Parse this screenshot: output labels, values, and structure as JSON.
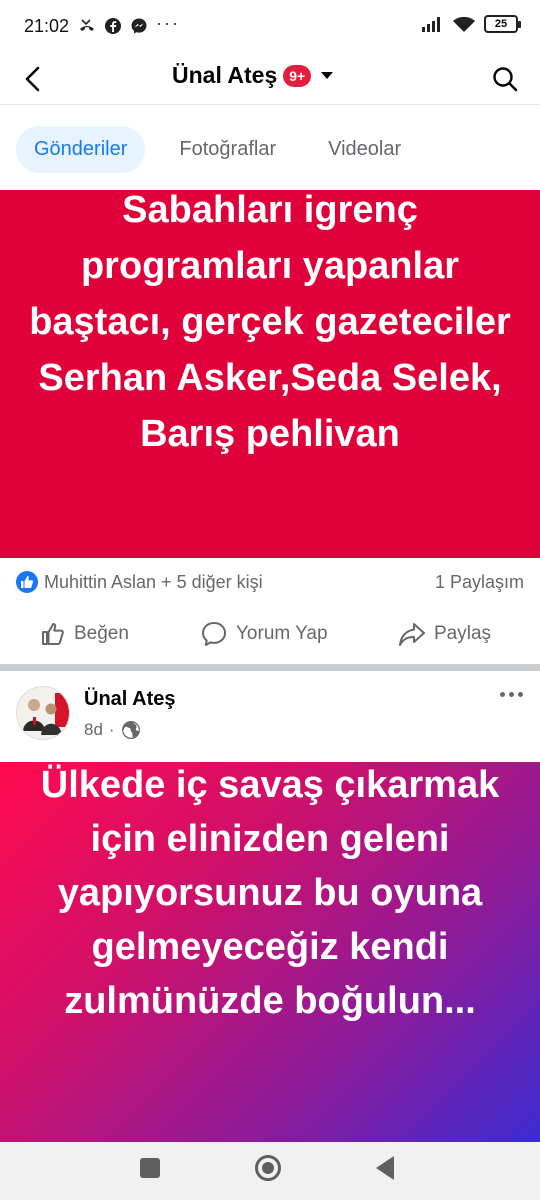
{
  "status_bar": {
    "time": "21:02",
    "dots": "···",
    "battery": "25"
  },
  "header": {
    "title": "Ünal Ateş",
    "badge": "9+"
  },
  "tabs": [
    {
      "label": "Gönderiler",
      "active": true
    },
    {
      "label": "Fotoğraflar",
      "active": false
    },
    {
      "label": "Videolar",
      "active": false
    }
  ],
  "post1": {
    "text": "Sabahları igrenç programları yapanlar baştacı, gerçek gazeteciler Serhan Asker,Seda Selek, Barış pehlivan",
    "background": "#e0003a",
    "reactions": "Muhittin Aslan + 5 diğer kişi",
    "shares": "1 Paylaşım",
    "actions": {
      "like": "Beğen",
      "comment": "Yorum Yap",
      "share": "Paylaş"
    }
  },
  "post2": {
    "author": "Ünal Ateş",
    "time": "8d",
    "text": "Ülkede iç savaş çıkarmak için elinizden geleni yapıyorsunuz bu oyuna gelmeyeceğiz kendi zulmünüzde boğulun..."
  },
  "colors": {
    "accent": "#1877f2",
    "badge": "#e41e3f",
    "text_secondary": "#65676b"
  },
  "icons": [
    "missed-call-icon",
    "facebook-icon",
    "messenger-icon",
    "signal-icon",
    "wifi-icon",
    "back-arrow-icon",
    "caret-down-icon",
    "search-icon",
    "like-icon",
    "comment-icon",
    "share-icon",
    "globe-icon",
    "more-icon"
  ]
}
